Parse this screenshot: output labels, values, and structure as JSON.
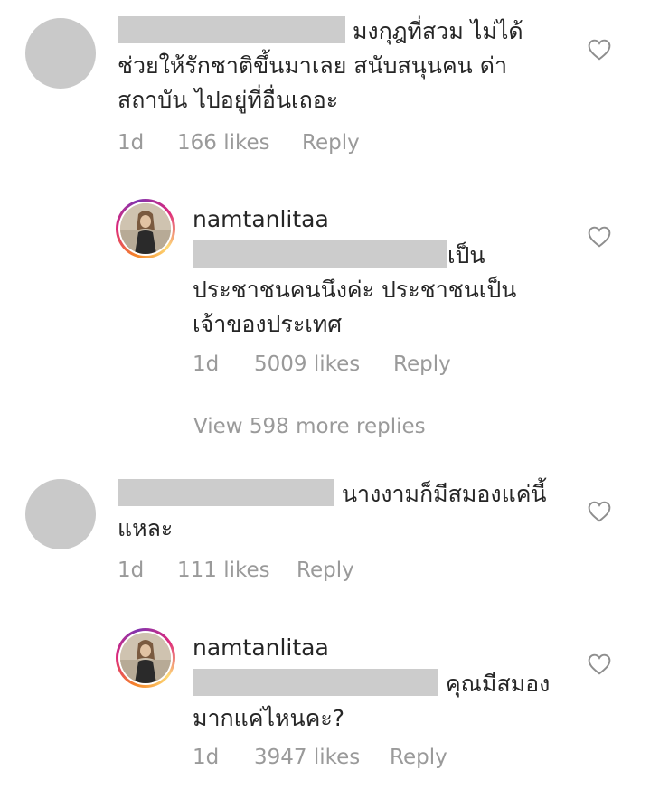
{
  "comments": [
    {
      "text": "มงกุฎที่สวม ไม่ได้ช่วยให้รักชาติขึ้นมาเลย สนับสนุนคน ด่าสถาบัน ไปอยู่ที่อื่นเถอะ",
      "line1": "มงกุฎที่สวม ไม่ได้",
      "line2": "ช่วยให้รักชาติขึ้นมาเลย สนับสนุนคน ด่า",
      "line3": "สถาบัน ไปอยู่ที่อื่นเถอะ",
      "time": "1d",
      "likes": "166 likes",
      "reply": "Reply"
    },
    {
      "username": "namtanlitaa",
      "line1": "เป็น",
      "line2": "ประชาชนคนนึงค่ะ ประชาชนเป็น",
      "line3": "เจ้าของประเทศ",
      "time": "1d",
      "likes": "5009 likes",
      "reply": "Reply"
    },
    {
      "line1": "นางงามก็มีสมองแค่นี้",
      "line2": "แหละ",
      "time": "1d",
      "likes": "111 likes",
      "reply": "Reply"
    },
    {
      "username": "namtanlitaa",
      "line1": "คุณมีสมอง",
      "line2": "มากแค่ไหนคะ?",
      "time": "1d",
      "likes": "3947 likes",
      "reply": "Reply"
    }
  ],
  "view_more": "View 598 more replies",
  "icons": {
    "like": "heart-outline-icon",
    "avatar_placeholder": "grey-circle"
  },
  "colors": {
    "text": "#262626",
    "meta": "#9a9a9a",
    "redaction": "#cccccc"
  }
}
